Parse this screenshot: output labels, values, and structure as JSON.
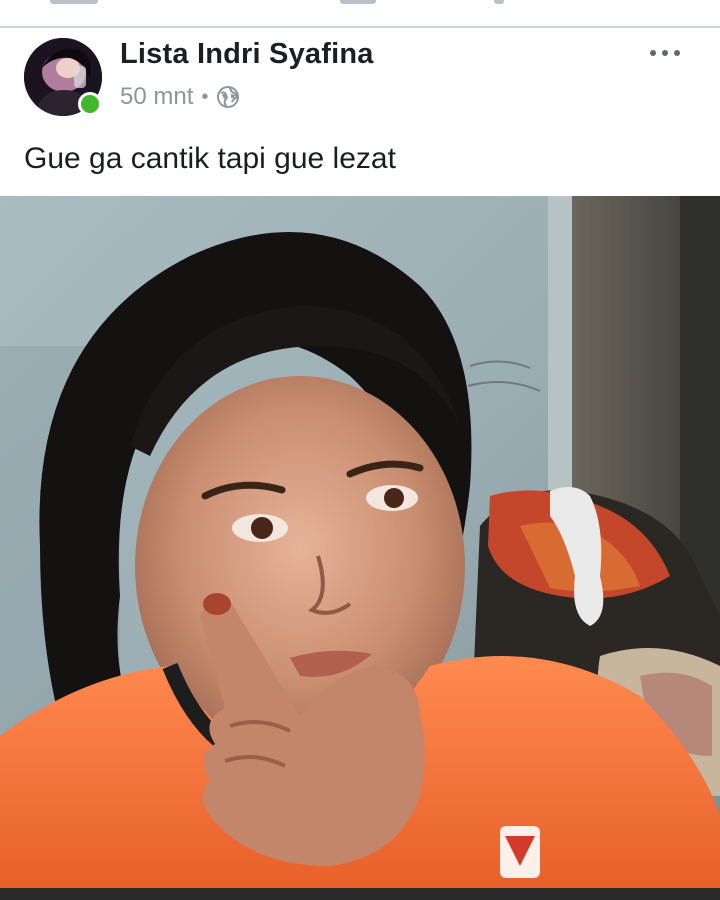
{
  "post": {
    "author_name": "Lista Indri Syafina",
    "timestamp": "50 mnt",
    "separator": "•",
    "privacy_icon": "globe-icon",
    "more_icon": "more-options-icon",
    "body_text": "Gue ga cantik tapi gue lezat",
    "online_status_color": "#42b72a"
  },
  "colors": {
    "name_text": "#1c1e21",
    "meta_text": "#90949c",
    "divider": "#cfd3d8"
  }
}
